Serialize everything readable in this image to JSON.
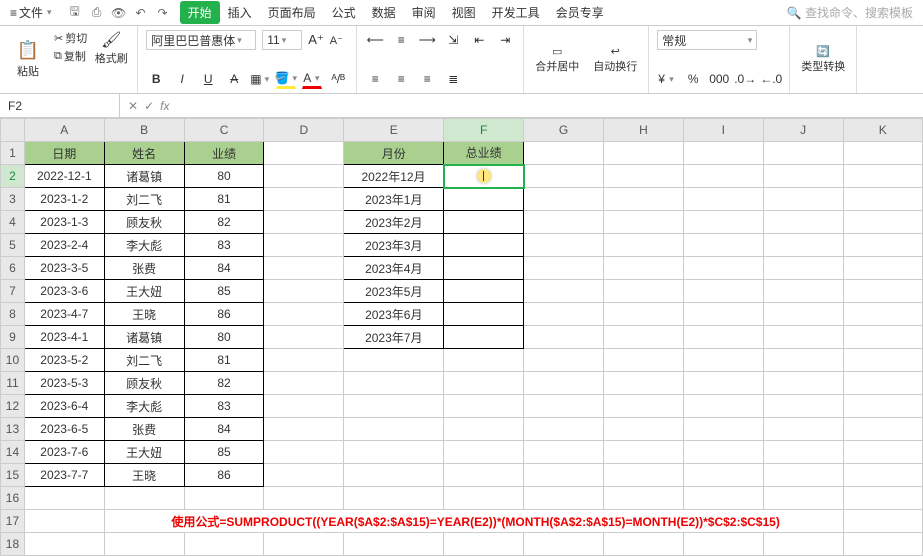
{
  "menubar": {
    "file": "文件",
    "tabs": [
      "开始",
      "插入",
      "页面布局",
      "公式",
      "数据",
      "审阅",
      "视图",
      "开发工具",
      "会员专享"
    ],
    "active_tab": "开始",
    "search_placeholder": "查找命令、搜索模板"
  },
  "ribbon": {
    "paste": "粘贴",
    "cut": "剪切",
    "copy": "复制",
    "painter": "格式刷",
    "font_name": "阿里巴巴普惠体",
    "font_size": "11",
    "merge": "合并居中",
    "wrap": "自动换行",
    "num_format": "常规",
    "type_convert": "类型转换"
  },
  "formula_bar": {
    "cell_ref": "F2",
    "formula": ""
  },
  "columns": [
    "A",
    "B",
    "C",
    "D",
    "E",
    "F",
    "G",
    "H",
    "I",
    "J",
    "K"
  ],
  "row_count": 18,
  "active_col": 5,
  "active_row": 2,
  "table1": {
    "headers": [
      "日期",
      "姓名",
      "业绩"
    ],
    "rows": [
      [
        "2022-12-1",
        "诸葛镇",
        "80"
      ],
      [
        "2023-1-2",
        "刘二飞",
        "81"
      ],
      [
        "2023-1-3",
        "顾友秋",
        "82"
      ],
      [
        "2023-2-4",
        "李大彪",
        "83"
      ],
      [
        "2023-3-5",
        "张费",
        "84"
      ],
      [
        "2023-3-6",
        "王大妞",
        "85"
      ],
      [
        "2023-4-7",
        "王晓",
        "86"
      ],
      [
        "2023-4-1",
        "诸葛镇",
        "80"
      ],
      [
        "2023-5-2",
        "刘二飞",
        "81"
      ],
      [
        "2023-5-3",
        "顾友秋",
        "82"
      ],
      [
        "2023-6-4",
        "李大彪",
        "83"
      ],
      [
        "2023-6-5",
        "张费",
        "84"
      ],
      [
        "2023-7-6",
        "王大妞",
        "85"
      ],
      [
        "2023-7-7",
        "王晓",
        "86"
      ]
    ]
  },
  "table2": {
    "headers": [
      "月份",
      "总业绩"
    ],
    "rows": [
      [
        "2022年12月",
        ""
      ],
      [
        "2023年1月",
        ""
      ],
      [
        "2023年2月",
        ""
      ],
      [
        "2023年3月",
        ""
      ],
      [
        "2023年4月",
        ""
      ],
      [
        "2023年5月",
        ""
      ],
      [
        "2023年6月",
        ""
      ],
      [
        "2023年7月",
        ""
      ]
    ]
  },
  "formula_note": "使用公式=SUMPRODUCT((YEAR($A$2:$A$15)=YEAR(E2))*(MONTH($A$2:$A$15)=MONTH(E2))*$C$2:$C$15)"
}
